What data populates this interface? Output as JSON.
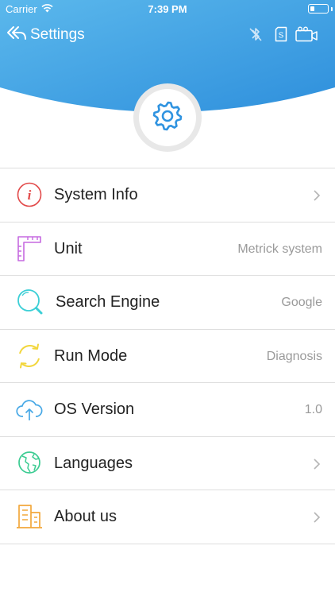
{
  "status_bar": {
    "carrier": "Carrier",
    "time": "7:39 PM",
    "battery_level": 0.25
  },
  "nav": {
    "back_label": "Settings",
    "icons": [
      "bluetooth-off-icon",
      "sd-card-icon",
      "camera-icon"
    ]
  },
  "colors": {
    "header_blue_top": "#5bb8ec",
    "header_blue_bottom": "#2e8fdc",
    "gear_blue": "#2f93e0"
  },
  "menu": {
    "items": [
      {
        "label": "System Info",
        "value": "",
        "icon": "info-icon",
        "chevron": true
      },
      {
        "label": "Unit",
        "value": "Metrick system",
        "icon": "ruler-icon",
        "chevron": false
      },
      {
        "label": "Search Engine",
        "value": "Google",
        "icon": "magnifier-icon",
        "chevron": false
      },
      {
        "label": "Run Mode",
        "value": "Diagnosis",
        "icon": "cycle-icon",
        "chevron": false
      },
      {
        "label": "OS Version",
        "value": "1.0",
        "icon": "cloud-upload-icon",
        "chevron": false
      },
      {
        "label": "Languages",
        "value": "",
        "icon": "globe-icon",
        "chevron": true
      },
      {
        "label": "About us",
        "value": "",
        "icon": "building-icon",
        "chevron": true
      }
    ]
  }
}
